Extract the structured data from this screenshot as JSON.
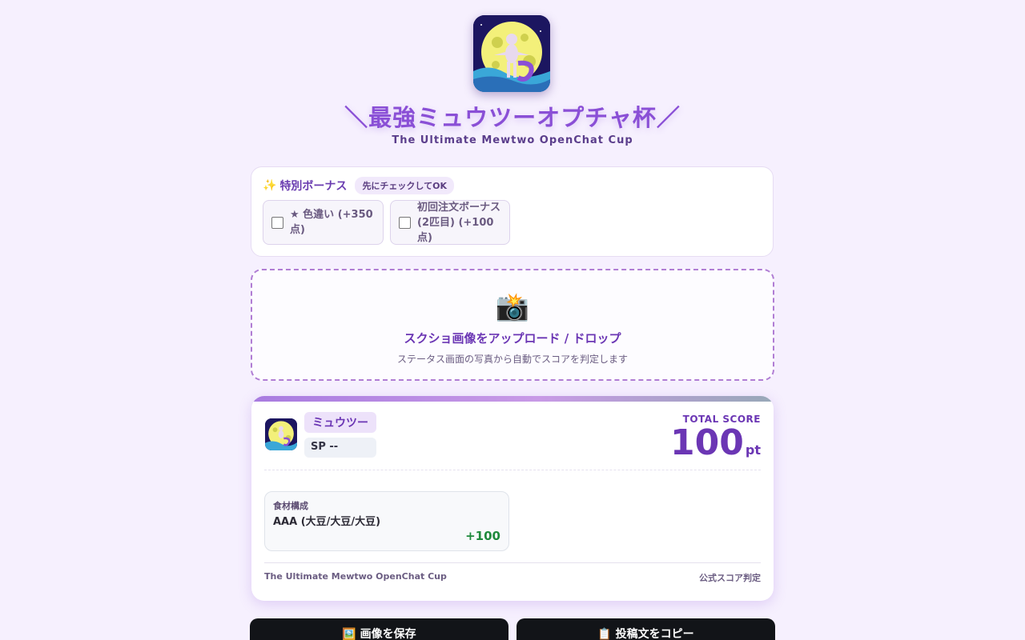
{
  "header": {
    "title": "＼最強ミュウツーオプチャ杯／",
    "subtitle": "The Ultimate Mewtwo OpenChat Cup",
    "logo_icon": "mewtwo-moon-logo"
  },
  "bonus": {
    "title": "特別ボーナス",
    "sparkle_icon": "✨",
    "pill": "先にチェックしてOK",
    "options": [
      {
        "label": "★ 色違い (+350点)",
        "checked": false
      },
      {
        "label": "初回注文ボーナス(2匹目) (+100点)",
        "checked": false
      }
    ]
  },
  "upload": {
    "icon": "📸",
    "title": "スクショ画像をアップロード / ドロップ",
    "subtitle": "ステータス画面の写真から自動でスコアを判定します"
  },
  "result": {
    "name": "ミュウツー",
    "sp": "SP --",
    "total_label": "TOTAL SCORE",
    "total_value": "100",
    "total_unit": "pt",
    "ingredient": {
      "label": "食材構成",
      "value": "AAA (大豆/大豆/大豆)",
      "points": "+100"
    },
    "footer_left": "The Ultimate Mewtwo OpenChat Cup",
    "footer_right": "公式スコア判定"
  },
  "actions": {
    "save_label": "🖼️ 画像を保存",
    "copy_label": "📋 投稿文をコピー"
  },
  "colors": {
    "background": "#f6f0fe",
    "accent": "#6b36b4",
    "score_green": "#1f8a3c",
    "button_dark": "#121418"
  }
}
